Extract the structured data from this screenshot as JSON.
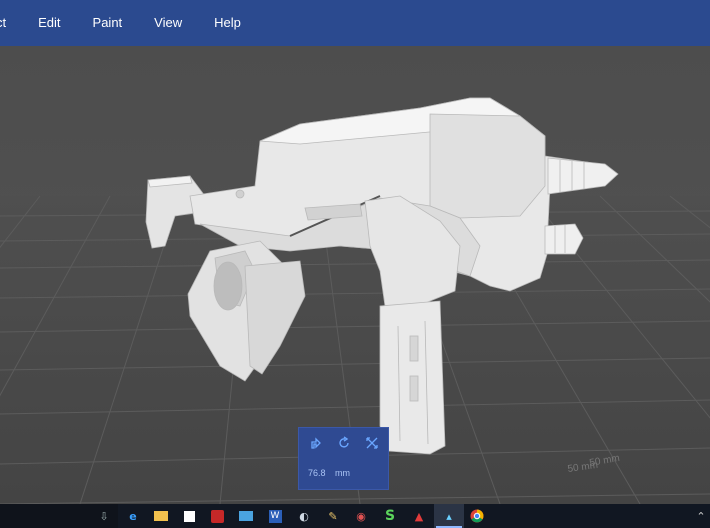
{
  "menubar": {
    "items": [
      {
        "label": "ct"
      },
      {
        "label": "Edit"
      },
      {
        "label": "Paint"
      },
      {
        "label": "View"
      },
      {
        "label": "Help"
      }
    ]
  },
  "viewport": {
    "floor_labels": [
      "50 mm",
      "50 mm"
    ]
  },
  "tool_panel": {
    "tools": [
      "move-icon",
      "rotate-icon",
      "scale-icon"
    ],
    "dimension_value": "76.8",
    "dimension_unit": "mm"
  },
  "colors": {
    "menubar": "#2b4a8f",
    "panel": "#2f4a92",
    "taskbar": "#111722",
    "model": "#e6e6e6"
  },
  "taskbar": {
    "icons": [
      "download-icon",
      "edge-icon",
      "file-explorer-icon",
      "store-icon",
      "power-app-icon",
      "photos-icon",
      "word-icon",
      "steam-icon",
      "paint-icon",
      "eye-app-icon",
      "s-app-icon",
      "vlc-app-icon",
      "active-app-icon",
      "chrome-icon",
      "chevron-up-icon"
    ]
  }
}
